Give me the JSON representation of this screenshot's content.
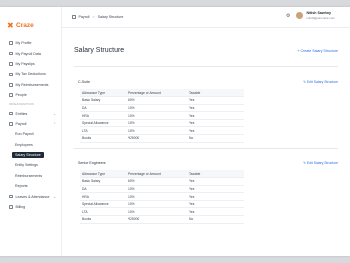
{
  "app": {
    "name": "Craze",
    "accent": "#f2711c"
  },
  "sidebar": {
    "items": [
      {
        "label": "My Profile",
        "icon": "user-icon"
      },
      {
        "label": "My Payroll Data",
        "icon": "wallet-icon"
      },
      {
        "label": "My Payslips",
        "icon": "document-icon"
      },
      {
        "label": "My Tax Deductions",
        "icon": "receipt-icon"
      },
      {
        "label": "My Reimbursements",
        "icon": "cash-icon"
      },
      {
        "label": "People",
        "icon": "people-icon"
      }
    ],
    "section_label": "ORGANIZATION",
    "org_items": [
      {
        "label": "Entities",
        "icon": "building-icon"
      },
      {
        "label": "Payroll",
        "icon": "payroll-icon"
      }
    ],
    "payroll_sub": [
      "Run Payroll",
      "Employees",
      "Salary Structure",
      "Entity Settings",
      "Reimbursements",
      "Reports"
    ],
    "bottom_items": [
      {
        "label": "Leaves & Attendance",
        "icon": "calendar-icon"
      },
      {
        "label": "Billing",
        "icon": "billing-icon"
      }
    ]
  },
  "header": {
    "breadcrumb_root": "Payroll",
    "breadcrumb_sep": ">",
    "breadcrumb_current": "Salary Structure",
    "user_name": "Nitish Sawhny",
    "user_email": "nitish@joincraze.com"
  },
  "main": {
    "title": "Salary Structure",
    "create_label": "+ Create Salary Structure",
    "columns": [
      "Allowance Type",
      "Percentage or Amount",
      "Taxable"
    ],
    "edit_label": "Edit Salary Structure",
    "structures": [
      {
        "name": "C-Suite",
        "rows": [
          [
            "Basic Salary",
            "60%",
            "Yes"
          ],
          [
            "DA",
            "10%",
            "Yes"
          ],
          [
            "HRA",
            "10%",
            "Yes"
          ],
          [
            "Special Allowance",
            "10%",
            "Yes"
          ],
          [
            "LTA",
            "10%",
            "Yes"
          ],
          [
            "Books",
            "₹25000",
            "No"
          ]
        ]
      },
      {
        "name": "Senior Engineers",
        "rows": [
          [
            "Basic Salary",
            "60%",
            "Yes"
          ],
          [
            "DA",
            "10%",
            "Yes"
          ],
          [
            "HRA",
            "10%",
            "Yes"
          ],
          [
            "Special Allowance",
            "10%",
            "Yes"
          ],
          [
            "LTA",
            "10%",
            "Yes"
          ],
          [
            "Books",
            "₹25000",
            "No"
          ]
        ]
      }
    ]
  },
  "colors": {
    "link": "#2f6fd8",
    "active_nav": "#1f2937"
  }
}
